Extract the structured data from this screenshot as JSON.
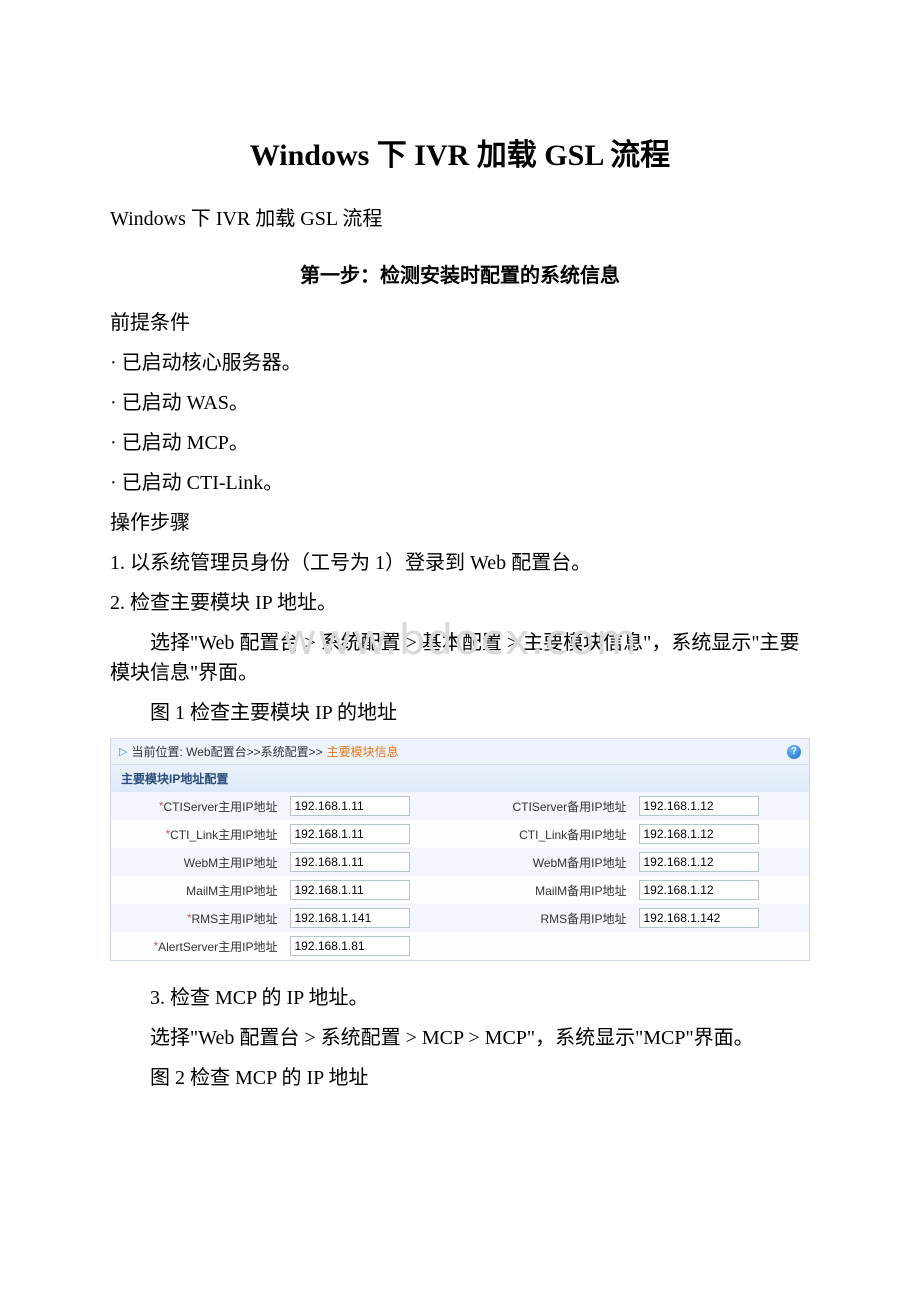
{
  "doc": {
    "title": "Windows 下 IVR 加载 GSL 流程",
    "subtitle": "Windows 下 IVR 加载 GSL 流程",
    "step1_heading": "第一步：检测安装时配置的系统信息",
    "precondition_label": "前提条件",
    "prec_1": "· 已启动核心服务器。",
    "prec_2": "· 已启动 WAS。",
    "prec_3": "· 已启动 MCP。",
    "prec_4": "· 已启动 CTI-Link。",
    "steps_label": "操作步骤",
    "step_1": "1. 以系统管理员身份（工号为 1）登录到 Web 配置台。",
    "step_2": "2. 检查主要模块 IP 地址。",
    "step_2_desc": "选择\"Web 配置台 > 系统配置 > 基本配置 > 主要模块信息\"，系统显示\"主要模块信息\"界面。",
    "fig1_caption": "图 1 检查主要模块 IP 的地址",
    "step_3": "3. 检查 MCP 的 IP 地址。",
    "step_3_desc": "选择\"Web 配置台 > 系统配置 > MCP > MCP\"，系统显示\"MCP\"界面。",
    "fig2_caption": "图 2 检查 MCP 的 IP 地址",
    "watermark": "www.bdocx.com"
  },
  "panel": {
    "breadcrumb_prefix": "当前位置: Web配置台>>系统配置>>",
    "breadcrumb_current": "主要模块信息",
    "help_glyph": "?",
    "section_title": "主要模块IP地址配置",
    "rows": [
      {
        "left": {
          "req": true,
          "label": "CTIServer主用IP地址",
          "value": "192.168.1.11"
        },
        "right": {
          "req": false,
          "label": "CTIServer备用IP地址",
          "value": "192.168.1.12"
        }
      },
      {
        "left": {
          "req": true,
          "label": "CTI_Link主用IP地址",
          "value": "192.168.1.11"
        },
        "right": {
          "req": false,
          "label": "CTI_Link备用IP地址",
          "value": "192.168.1.12"
        }
      },
      {
        "left": {
          "req": false,
          "label": "WebM主用IP地址",
          "value": "192.168.1.11"
        },
        "right": {
          "req": false,
          "label": "WebM备用IP地址",
          "value": "192.168.1.12"
        }
      },
      {
        "left": {
          "req": false,
          "label": "MailM主用IP地址",
          "value": "192.168.1.11"
        },
        "right": {
          "req": false,
          "label": "MailM备用IP地址",
          "value": "192.168.1.12"
        }
      },
      {
        "left": {
          "req": true,
          "label": "RMS主用IP地址",
          "value": "192.168.1.141"
        },
        "right": {
          "req": false,
          "label": "RMS备用IP地址",
          "value": "192.168.1.142"
        }
      },
      {
        "left": {
          "req": true,
          "label": "AlertServer主用IP地址",
          "value": "192.168.1.81"
        },
        "right": null
      }
    ]
  }
}
